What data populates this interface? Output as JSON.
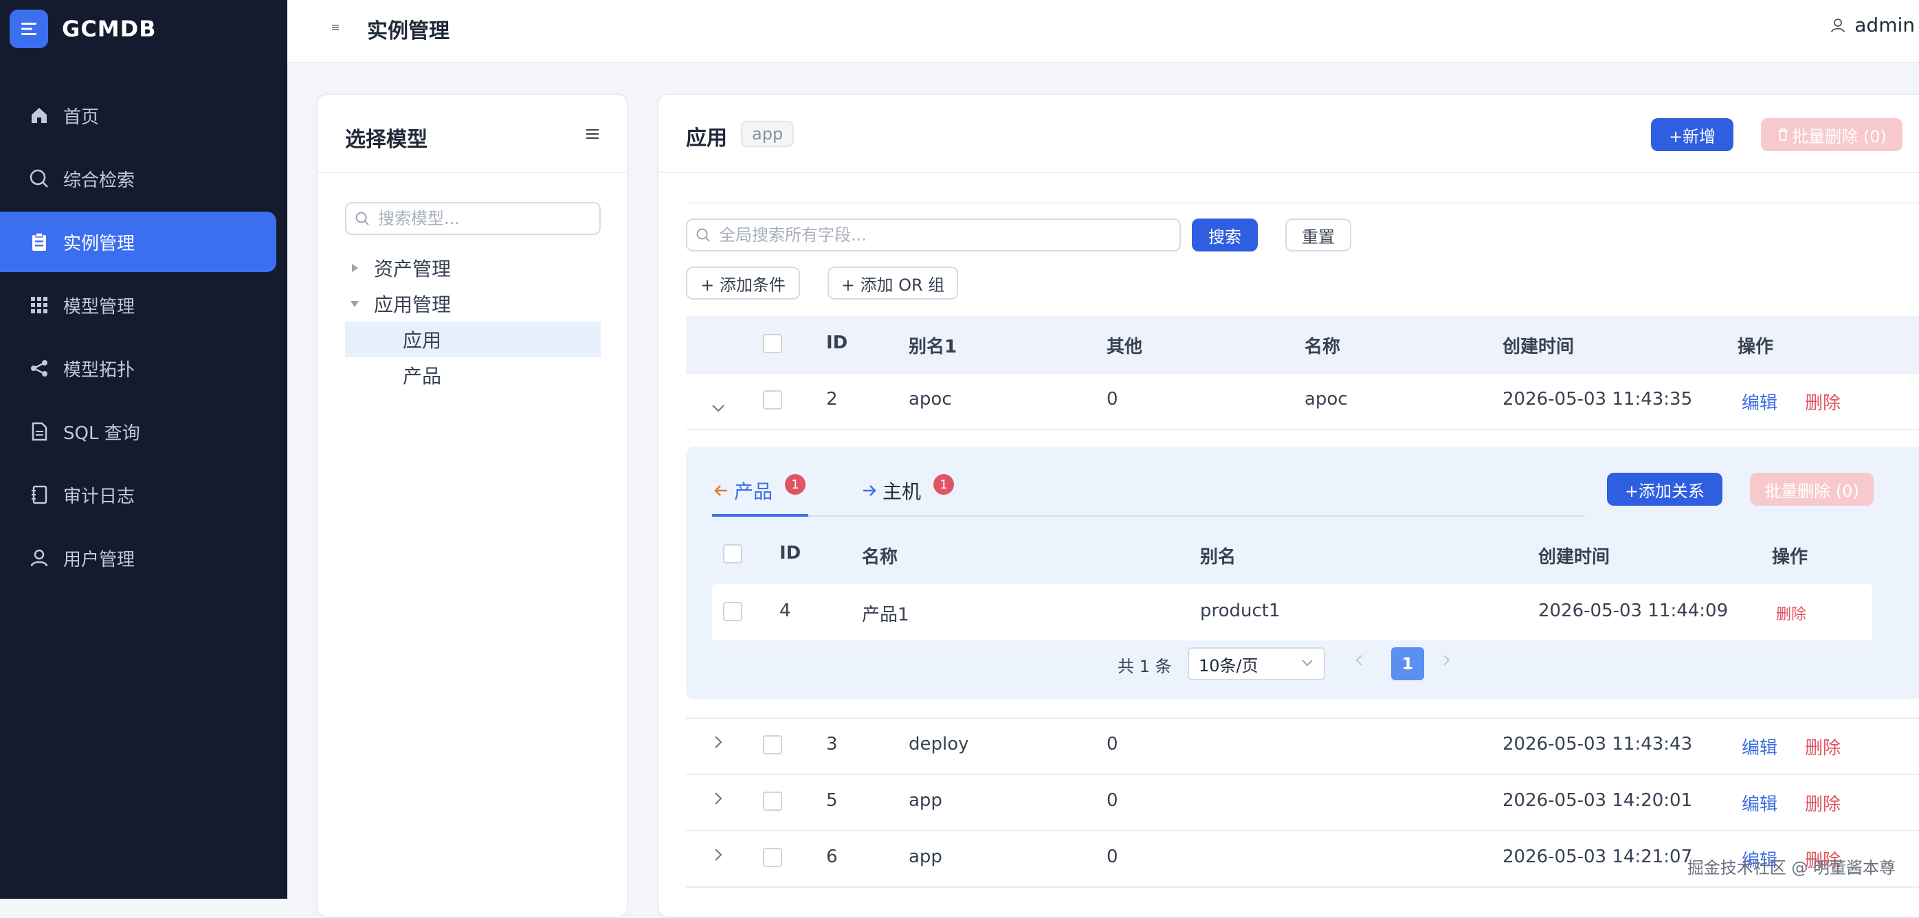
{
  "app": {
    "logo_text": "GCMDB"
  },
  "sidebar": {
    "items": [
      {
        "label": "首页",
        "icon": "home-icon",
        "active": false
      },
      {
        "label": "综合检索",
        "icon": "search-icon",
        "active": false
      },
      {
        "label": "实例管理",
        "icon": "clipboard-icon",
        "active": true
      },
      {
        "label": "模型管理",
        "icon": "grid-icon",
        "active": false
      },
      {
        "label": "模型拓扑",
        "icon": "share-icon",
        "active": false
      },
      {
        "label": "SQL 查询",
        "icon": "document-icon",
        "active": false
      },
      {
        "label": "审计日志",
        "icon": "notebook-icon",
        "active": false
      },
      {
        "label": "用户管理",
        "icon": "user-icon",
        "active": false
      }
    ]
  },
  "header": {
    "title": "实例管理",
    "user": "admin"
  },
  "model_panel": {
    "title": "选择模型",
    "search_placeholder": "搜索模型...",
    "tree": [
      {
        "label": "资产管理",
        "expanded": false,
        "level": 0
      },
      {
        "label": "应用管理",
        "expanded": true,
        "level": 0
      },
      {
        "label": "应用",
        "level": 1,
        "selected": true
      },
      {
        "label": "产品",
        "level": 1,
        "selected": false
      }
    ]
  },
  "instance_panel": {
    "title": "应用",
    "tag": "app",
    "add_label": "+新增",
    "batch_delete_label": "批量删除 (0)",
    "search_placeholder": "全局搜索所有字段...",
    "search_button": "搜索",
    "reset_button": "重置",
    "add_condition": "+ 添加条件",
    "add_or_group": "+ 添加 OR 组",
    "columns": [
      "ID",
      "别名1",
      "其他",
      "名称",
      "创建时间",
      "操作"
    ],
    "edit_label": "编辑",
    "delete_label": "删除",
    "rows": [
      {
        "id": "2",
        "alias": "apoc",
        "other": "0",
        "name": "apoc",
        "created": "2026-05-03 11:43:35",
        "expanded": true
      },
      {
        "id": "3",
        "alias": "deploy",
        "other": "0",
        "name": "",
        "created": "2026-05-03 11:43:43",
        "expanded": false
      },
      {
        "id": "5",
        "alias": "app",
        "other": "0",
        "name": "",
        "created": "2026-05-03 14:20:01",
        "expanded": false
      },
      {
        "id": "6",
        "alias": "app",
        "other": "0",
        "name": "",
        "created": "2026-05-03 14:21:07",
        "expanded": false
      }
    ]
  },
  "relations": {
    "tabs": [
      {
        "label": "产品",
        "count": "1",
        "direction": "left",
        "active": true
      },
      {
        "label": "主机",
        "count": "1",
        "direction": "right",
        "active": false
      }
    ],
    "add_relation": "+添加关系",
    "batch_delete": "批量删除 (0)",
    "columns": [
      "ID",
      "名称",
      "别名",
      "创建时间",
      "操作"
    ],
    "rows": [
      {
        "id": "4",
        "name": "产品1",
        "alias": "product1",
        "created": "2026-05-03 11:44:09",
        "action": "删除"
      }
    ],
    "pagination": {
      "total": "共 1 条",
      "page_size": "10条/页",
      "current": "1"
    }
  },
  "colors": {
    "accent": "#3b6ff0",
    "sidebar_bg": "#151b2e",
    "danger": "#e0555f"
  },
  "watermark": "掘金技术社区 @ 明董酱本尊"
}
